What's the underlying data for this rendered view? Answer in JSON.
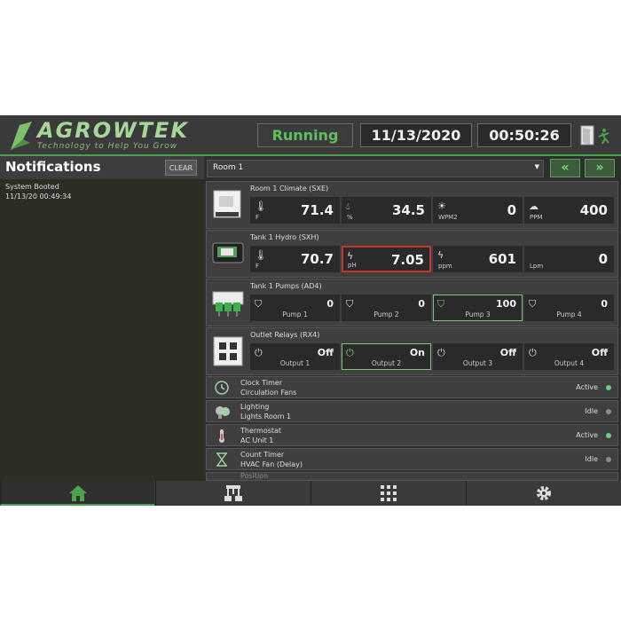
{
  "header": {
    "brand": "AGROWTEK",
    "tagline": "Technology to Help You Grow",
    "status": "Running",
    "date": "11/13/2020",
    "time": "00:50:26",
    "status_color": "#5fbf5f",
    "exit_icon": "exit-door-icon"
  },
  "notifications": {
    "title": "Notifications",
    "clear_label": "CLEAR",
    "items": [
      {
        "text": "System Booted",
        "timestamp": "11/13/20 00:49:34"
      }
    ]
  },
  "room": {
    "selected": "Room 1",
    "prev_label": "«",
    "next_label": "»"
  },
  "devices": [
    {
      "title": "Room 1 Climate  (SXE)",
      "icon": "climate-controller-icon",
      "tiles": [
        {
          "icon": "thermometer-icon",
          "unit": "F",
          "value": "71.4"
        },
        {
          "icon": "humidity-drop-icon",
          "unit": "%",
          "value": "34.5"
        },
        {
          "icon": "sun-icon",
          "unit": "WPM2",
          "value": "0"
        },
        {
          "icon": "co2-cloud-icon",
          "unit": "PPM",
          "value": "400"
        }
      ]
    },
    {
      "title": "Tank 1 Hydro  (SXH)",
      "icon": "hydro-controller-icon",
      "tiles": [
        {
          "icon": "thermometer-icon",
          "unit": "F",
          "value": "70.7"
        },
        {
          "icon": "ph-icon",
          "unit": "pH",
          "value": "7.05",
          "alarm": true
        },
        {
          "icon": "ec-icon",
          "unit": "ppm",
          "value": "601"
        },
        {
          "icon": "flow-icon",
          "unit": "Lpm",
          "value": "0"
        }
      ]
    },
    {
      "title": "Tank 1 Pumps  (AD4)",
      "icon": "pump-doser-icon",
      "tiles": [
        {
          "icon": "pump-icon",
          "label": "Pump 1",
          "value": "0"
        },
        {
          "icon": "pump-icon",
          "label": "Pump 2",
          "value": "0"
        },
        {
          "icon": "pump-icon",
          "label": "Pump 3",
          "value": "100",
          "active": true
        },
        {
          "icon": "pump-icon",
          "label": "Pump 4",
          "value": "0"
        }
      ]
    },
    {
      "title": "Outlet Relays  (RX4)",
      "icon": "outlet-relay-icon",
      "tiles": [
        {
          "icon": "power-icon",
          "label": "Output 1",
          "value": "Off"
        },
        {
          "icon": "power-icon",
          "label": "Output 2",
          "value": "On",
          "active": true
        },
        {
          "icon": "power-icon",
          "label": "Output 3",
          "value": "Off"
        },
        {
          "icon": "power-icon",
          "label": "Output 4",
          "value": "Off"
        }
      ]
    }
  ],
  "rules": [
    {
      "type": "Clock Timer",
      "name": "Circulation Fans",
      "state": "Active",
      "icon": "clock-icon",
      "dot_color": "#6fcf6f"
    },
    {
      "type": "Lighting",
      "name": "Lights Room 1",
      "state": "Idle",
      "icon": "light-bulb-icon",
      "dot_color": "#8a8a8a"
    },
    {
      "type": "Thermostat",
      "name": "AC Unit 1",
      "state": "Active",
      "icon": "thermostat-icon",
      "dot_color": "#6fcf6f"
    },
    {
      "type": "Count Timer",
      "name": "HVAC Fan (Delay)",
      "state": "Idle",
      "icon": "hourglass-icon",
      "dot_color": "#8a8a8a"
    },
    {
      "type": "Position",
      "name": "",
      "state": "",
      "icon": "position-icon",
      "dot_color": "#8a8a8a"
    }
  ],
  "bottom_nav": [
    {
      "icon": "home-icon",
      "active": true
    },
    {
      "icon": "network-icon",
      "active": false
    },
    {
      "icon": "grid-apps-icon",
      "active": false
    },
    {
      "icon": "gear-icon",
      "active": false
    }
  ],
  "colors": {
    "accent_green": "#4ea24e",
    "alarm_red": "#c0392b",
    "panel_bg": "#3f3f3f"
  }
}
